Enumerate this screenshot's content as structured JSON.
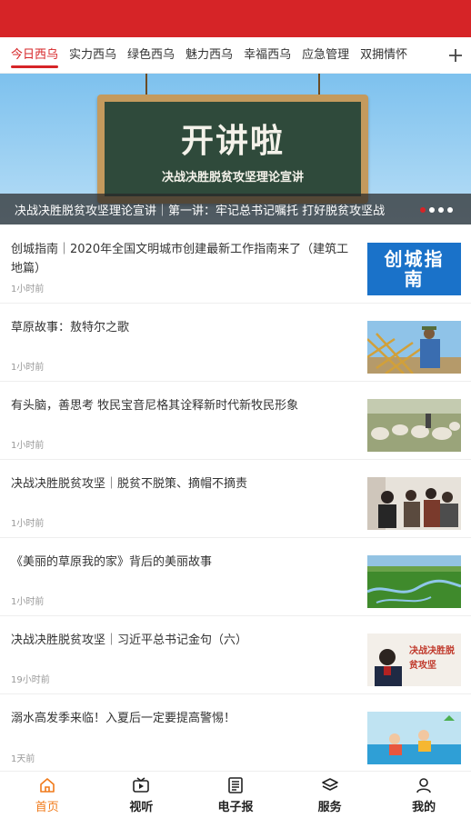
{
  "tabs": {
    "items": [
      "今日西乌",
      "实力西乌",
      "绿色西乌",
      "魅力西乌",
      "幸福西乌",
      "应急管理",
      "双拥情怀"
    ],
    "plus_icon": "plus-icon"
  },
  "banner": {
    "board_title": "开讲啦",
    "board_subtitle": "决战决胜脱贫攻坚理论宣讲",
    "caption": "决战决胜脱贫攻坚理论宣讲｜第一讲：牢记总书记嘱托 打好脱贫攻坚战"
  },
  "news": [
    {
      "title": "创城指南｜2020年全国文明城市创建最新工作指南来了（建筑工地篇）",
      "time": "1小时前",
      "thumb_text": "创城指南"
    },
    {
      "title": "草原故事：敖特尔之歌",
      "time": "1小时前"
    },
    {
      "title": "有头脑，善思考 牧民宝音尼格其诠释新时代新牧民形象",
      "time": "1小时前"
    },
    {
      "title": "决战决胜脱贫攻坚｜脱贫不脱策、摘帽不摘责",
      "time": "1小时前"
    },
    {
      "title": "《美丽的草原我的家》背后的美丽故事",
      "time": "1小时前"
    },
    {
      "title": "决战决胜脱贫攻坚｜习近平总书记金句（六）",
      "time": "19小时前",
      "thumb_text": "决战决胜脱贫攻坚"
    },
    {
      "title": "溺水高发季来临！入夏后一定要提高警惕！",
      "time": "1天前"
    }
  ],
  "nav": {
    "home": "首页",
    "video": "视听",
    "epaper": "电子报",
    "services": "服务",
    "mine": "我的"
  },
  "colors": {
    "brand": "#d62427",
    "nav_active": "#f07a1a"
  }
}
